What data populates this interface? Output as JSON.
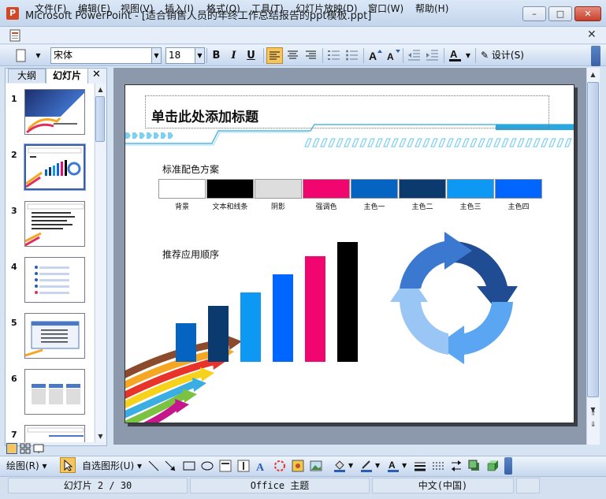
{
  "window": {
    "title": "Microsoft PowerPoint - [适合销售人员的年终工作总结报告的ppt模板.ppt]",
    "minimize": "–",
    "maximize": "□",
    "close": "✕"
  },
  "menu": {
    "items": [
      "文件(F)",
      "编辑(E)",
      "视图(V)",
      "插入(I)",
      "格式(O)",
      "工具(T)",
      "幻灯片放映(D)",
      "窗口(W)",
      "帮助(H)"
    ],
    "close_doc": "✕"
  },
  "toolbar": {
    "font_name": "宋体",
    "font_size": "18",
    "bold": "B",
    "italic": "I",
    "underline": "U",
    "design_label": "设计(S)"
  },
  "left_panel": {
    "tab_outline": "大纲",
    "tab_slides": "幻灯片",
    "close": "✕",
    "slide_numbers": [
      "1",
      "2",
      "3",
      "4",
      "5",
      "6",
      "7"
    ],
    "selected_slide": 2
  },
  "slide": {
    "title": "单击此处添加标题",
    "color_scheme_label": "标准配色方案",
    "order_label": "推荐应用顺序",
    "swatches": [
      {
        "label": "背景",
        "color": "#FFFFFF"
      },
      {
        "label": "文本和线条",
        "color": "#000000"
      },
      {
        "label": "阴影",
        "color": "#DDDDDD"
      },
      {
        "label": "强调色",
        "color": "#F0066E"
      },
      {
        "label": "主色一",
        "color": "#0563C1"
      },
      {
        "label": "主色二",
        "color": "#0A3A6E"
      },
      {
        "label": "主色三",
        "color": "#0D98F4"
      },
      {
        "label": "主色四",
        "color": "#0066FF"
      }
    ],
    "bars": [
      {
        "value": 0.32,
        "color": "#0563C1"
      },
      {
        "value": 0.47,
        "color": "#0A3A6E"
      },
      {
        "value": 0.58,
        "color": "#0D98F4"
      },
      {
        "value": 0.73,
        "color": "#0066FF"
      },
      {
        "value": 0.88,
        "color": "#F0066E"
      },
      {
        "value": 1.0,
        "color": "#000000"
      }
    ]
  },
  "draw_toolbar": {
    "draw_label": "绘图(R)",
    "autoshapes_label": "自选图形(U)"
  },
  "status": {
    "slide_info": "幻灯片 2 / 30",
    "theme": "Office 主题",
    "language": "中文(中国)"
  }
}
